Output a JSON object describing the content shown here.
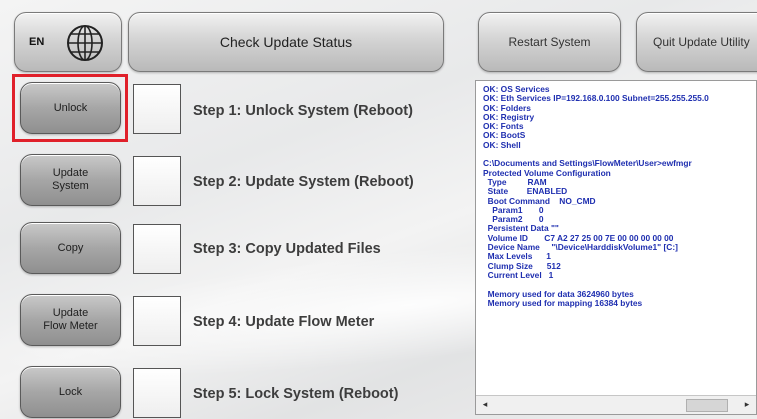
{
  "top_bar": {
    "language_code": "EN",
    "check_update_label": "Check Update Status",
    "restart_label": "Restart System",
    "quit_label": "Quit Update Utility"
  },
  "steps": [
    {
      "button_line1": "Unlock",
      "button_line2": "",
      "label": "Step 1: Unlock System (Reboot)",
      "highlighted": true
    },
    {
      "button_line1": "Update",
      "button_line2": "System",
      "label": "Step 2: Update System (Reboot)",
      "highlighted": false
    },
    {
      "button_line1": "Copy",
      "button_line2": "",
      "label": "Step 3: Copy Updated Files",
      "highlighted": false
    },
    {
      "button_line1": "Update",
      "button_line2": "Flow Meter",
      "label": "Step 4: Update Flow Meter",
      "highlighted": false
    },
    {
      "button_line1": "Lock",
      "button_line2": "",
      "label": "Step 5: Lock System (Reboot)",
      "highlighted": false
    }
  ],
  "log": {
    "lines": [
      "OK: OS Services",
      "OK: Eth Services IP=192.168.0.100 Subnet=255.255.255.0",
      "OK: Folders",
      "OK: Registry",
      "OK: Fonts",
      "OK: BootS",
      "OK: Shell",
      "",
      "C:\\Documents and Settings\\FlowMeter\\User>ewfmgr",
      "Protected Volume Configuration",
      "  Type         RAM",
      "  State        ENABLED",
      "  Boot Command    NO_CMD",
      "    Param1       0",
      "    Param2       0",
      "  Persistent Data \"\"",
      "  Volume ID       C7 A2 27 25 00 7E 00 00 00 00 00",
      "  Device Name     \"\\Device\\HarddiskVolume1\" [C:]",
      "  Max Levels      1",
      "  Clump Size      512",
      "  Current Level   1",
      "",
      "  Memory used for data 3624960 bytes",
      "  Memory used for mapping 16384 bytes"
    ],
    "scroll_left": "◂",
    "scroll_right": "▸"
  }
}
